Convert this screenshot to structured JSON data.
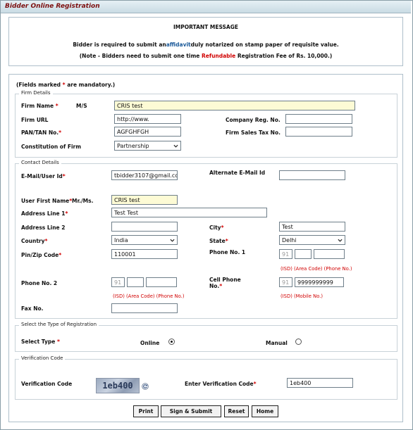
{
  "window_title": "Bidder Online Registration",
  "important_message": {
    "heading": "IMPORTANT MESSAGE",
    "line1_prefix": "Bidder is required to submit an",
    "line1_link": "affidavit",
    "line1_suffix": "duly notarized on stamp paper of requisite value.",
    "line2_prefix": "(Note - Bidders need to submit one time ",
    "line2_highlight": "Refundable",
    "line2_suffix": " Registration Fee of Rs. 10,000.)"
  },
  "mandatory_note_prefix": "(Fields marked ",
  "mandatory_note_star": "*",
  "mandatory_note_suffix": " are mandatory.)",
  "firm_details": {
    "legend": "Firm Details",
    "firm_name_label": "Firm Name",
    "firm_name_prefix": "M/S",
    "firm_name_value": "CRIS test",
    "firm_url_label": "Firm URL",
    "firm_url_value": "http://www.",
    "company_reg_label": "Company Reg. No.",
    "company_reg_value": "",
    "pan_label": "PAN/TAN No.",
    "pan_value": "AGFGHFGH",
    "sales_tax_label": "Firm Sales Tax No.",
    "sales_tax_value": "",
    "constitution_label": "Constitution of Firm",
    "constitution_value": "Partnership"
  },
  "contact_details": {
    "legend": "Contact Details",
    "email_label": "E-Mail/User Id",
    "email_value": "tbidder3107@gmail.co",
    "alt_email_label": "Alternate E-Mail Id",
    "alt_email_value": "",
    "first_name_label": "User First Name",
    "salutation": "Mr./Ms.",
    "first_name_value": "CRIS test",
    "address1_label": "Address Line 1",
    "address1_value": "Test Test",
    "address2_label": "Address Line 2",
    "address2_value": "",
    "city_label": "City",
    "city_value": "Test",
    "country_label": "Country",
    "country_value": "India",
    "state_label": "State",
    "state_value": "Delhi",
    "pin_label": "Pin/Zip Code",
    "pin_value": "110001",
    "phone1_label": "Phone No. 1",
    "phone1_isd": "91",
    "phone1_area": "",
    "phone1_number": "",
    "phone1_hint": "(ISD) (Area Code) (Phone No.)",
    "phone2_label": "Phone No. 2",
    "phone2_isd": "91",
    "phone2_area": "",
    "phone2_number": "",
    "phone2_hint": "(ISD) (Area Code) (Phone No.)",
    "cell_label_line1": "Cell Phone",
    "cell_label_line2": "No.",
    "cell_isd": "91",
    "cell_number": "9999999999",
    "cell_hint": "(ISD)     (Mobile No.)",
    "fax_label": "Fax No.",
    "fax_value": ""
  },
  "registration_type": {
    "legend": "Select the Type of Registration",
    "label": "Select Type",
    "online_label": "Online",
    "manual_label": "Manual",
    "selected": "Online"
  },
  "verification": {
    "legend": "Verification Code",
    "label": "Verification Code",
    "captcha_text": "1eb400",
    "enter_label": "Enter Verification Code",
    "enter_value": "1eb400"
  },
  "buttons": {
    "print": "Print",
    "sign_submit": "Sign & Submit",
    "reset": "Reset",
    "home": "Home"
  },
  "required_star": "*",
  "icons": {
    "dropdown": "chevron-down-icon",
    "refresh": "refresh-icon"
  },
  "colors": {
    "title": "#7d1010",
    "required": "#d10000",
    "link": "#1b5a9a",
    "highlight_input": "#fdfbd5"
  }
}
